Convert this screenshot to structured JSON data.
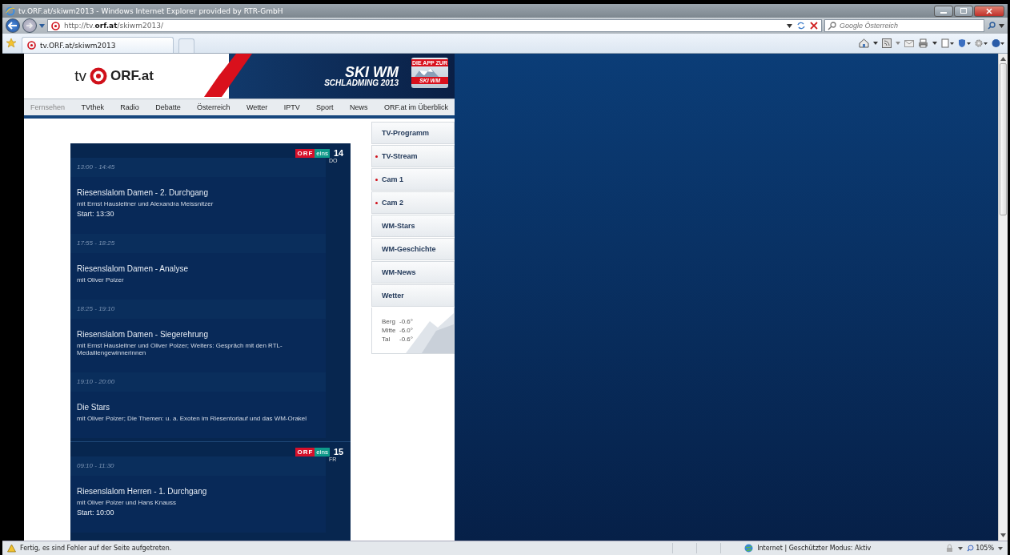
{
  "window": {
    "title": "tv.ORF.at/skiwm2013 - Windows Internet Explorer provided by RTR-GmbH"
  },
  "address": {
    "prefix": "http://tv.",
    "domain": "orf.at",
    "path": "/skiwm2013/"
  },
  "search": {
    "placeholder": "Google Österreich"
  },
  "tab": {
    "label": "tv.ORF.at/skiwm2013",
    "selected": true
  },
  "header": {
    "logo_tv": "tv",
    "logo_orf": "ORF.at",
    "banner_title": "SKI WM",
    "banner_subtitle": "SCHLADMING 2013",
    "app_ribbon": "DIE APP ZUR",
    "app_label": "SKI WM"
  },
  "nav": [
    {
      "label": "Fernsehen",
      "selected": true
    },
    {
      "label": "TVthek",
      "selected": false
    },
    {
      "label": "Radio",
      "selected": false
    },
    {
      "label": "Debatte",
      "selected": false
    },
    {
      "label": "Österreich",
      "selected": false
    },
    {
      "label": "Wetter",
      "selected": false
    },
    {
      "label": "IPTV",
      "selected": false
    },
    {
      "label": "Sport",
      "selected": false
    },
    {
      "label": "News",
      "selected": false
    },
    {
      "label": "ORF.at im Überblick",
      "selected": false
    }
  ],
  "days": [
    {
      "channel_a": "ORF",
      "channel_b": "eins",
      "day": "14",
      "weekday": "DO",
      "programs": [
        {
          "time": "13:00 - 14:45",
          "title": "Riesenslalom Damen - 2. Durchgang",
          "info": "mit Ernst Hausleitner und Alexandra Meissnitzer",
          "start": "Start: 13:30"
        },
        {
          "time": "17:55 - 18:25",
          "title": "Riesenslalom Damen - Analyse",
          "info": "mit Oliver Polzer"
        },
        {
          "time": "18:25 - 19:10",
          "title": "Riesenslalom Damen - Siegerehrung",
          "info": "mit Ernst Hausleitner und Oliver Polzer; Weiters: Gespräch mit den RTL-Medaillengewinnerinnen"
        },
        {
          "time": "19:10 - 20:00",
          "title": "Die Stars",
          "info": "mit Oliver Polzer; Die Themen: u. a. Exoten im Riesentorlauf und das WM-Orakel"
        }
      ]
    },
    {
      "channel_a": "ORF",
      "channel_b": "eins",
      "day": "15",
      "weekday": "FR",
      "programs": [
        {
          "time": "09:10 - 11:30",
          "title": "Riesenslalom Herren - 1. Durchgang",
          "info": "mit Oliver Polzer und Hans Knauss",
          "start": "Start: 10:00"
        }
      ]
    }
  ],
  "sidebar": [
    {
      "label": "TV-Programm",
      "live": false
    },
    {
      "label": "TV-Stream",
      "live": true
    },
    {
      "label": "Cam 1",
      "live": true
    },
    {
      "label": "Cam 2",
      "live": true
    },
    {
      "label": "WM-Stars",
      "live": false
    },
    {
      "label": "WM-Geschichte",
      "live": false
    },
    {
      "label": "WM-News",
      "live": false
    },
    {
      "label": "Wetter",
      "live": false
    }
  ],
  "weather": [
    {
      "place": "Berg",
      "temp": "-0.6°"
    },
    {
      "place": "Mitte",
      "temp": "-6.0°"
    },
    {
      "place": "Tal",
      "temp": "-0.6°"
    }
  ],
  "status_bar": {
    "message": "Fertig, es sind Fehler auf der Seite aufgetreten.",
    "zone": "Internet | Geschützter Modus: Aktiv",
    "zoom": "105%"
  }
}
